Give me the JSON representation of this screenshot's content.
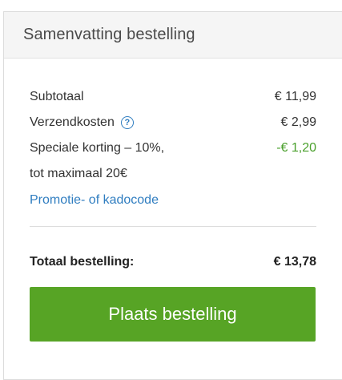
{
  "summary": {
    "title": "Samenvatting bestelling",
    "lines": [
      {
        "label": "Subtotaal",
        "value": "€ 11,99"
      },
      {
        "label": "Verzendkosten",
        "value": "€ 2,99",
        "help_icon": "question-circle-icon"
      },
      {
        "label_line1": "Speciale korting – 10%,",
        "label_line2": "tot maximaal 20€",
        "value": "-€ 1,20"
      }
    ],
    "promo_link": "Promotie- of kadocode",
    "total_label": "Totaal bestelling:",
    "total_value": "€ 13,78",
    "place_order_button": "Plaats bestelling",
    "colors": {
      "accent_green": "#57a425",
      "discount_green": "#4aa02c",
      "link_blue": "#2f7dc0"
    }
  }
}
